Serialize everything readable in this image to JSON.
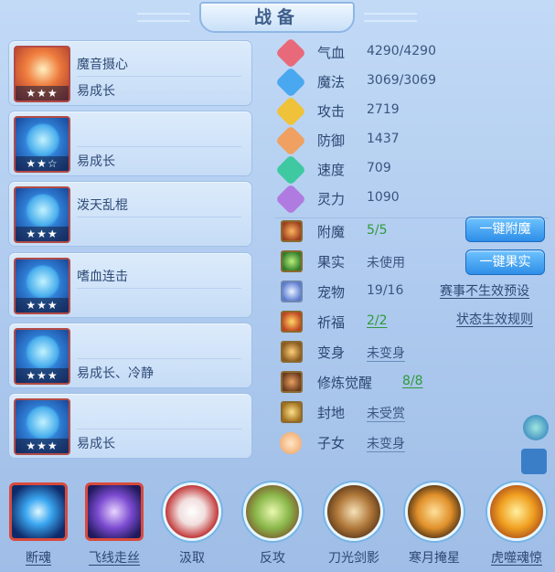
{
  "window": {
    "title": "战备"
  },
  "skills": [
    {
      "line1": "魔音摄心",
      "line2": "易成长",
      "stars": "★★★",
      "icon": "fire-popsicle-icon"
    },
    {
      "line1": "",
      "line2": "易成长",
      "stars": "★★☆",
      "icon": "blue-beast-icon"
    },
    {
      "line1": "泼天乱棍",
      "line2": "",
      "stars": "★★★",
      "icon": "blue-warrior-icon"
    },
    {
      "line1": "嗜血连击",
      "line2": "",
      "stars": "★★★",
      "icon": "blue-dragon-icon"
    },
    {
      "line1": "",
      "line2": "易成长、冷静",
      "stars": "★★★",
      "icon": "blue-armor-icon"
    },
    {
      "line1": "",
      "line2": "易成长",
      "stars": "★★★",
      "icon": "blue-spirit-icon"
    }
  ],
  "stats": [
    {
      "label": "气血",
      "value": "4290/4290",
      "icon": "heart-icon",
      "color": "#e86a7a"
    },
    {
      "label": "魔法",
      "value": "3069/3069",
      "icon": "mana-gem-icon",
      "color": "#4aa8f0"
    },
    {
      "label": "攻击",
      "value": "2719",
      "icon": "sword-icon",
      "color": "#f0c23a"
    },
    {
      "label": "防御",
      "value": "1437",
      "icon": "shield-icon",
      "color": "#f0a060"
    },
    {
      "label": "速度",
      "value": "709",
      "icon": "lightning-icon",
      "color": "#3ec9a0"
    },
    {
      "label": "灵力",
      "value": "1090",
      "icon": "spirit-icon",
      "color": "#b07be0"
    }
  ],
  "equipment": [
    {
      "label": "附魔",
      "value": "5/5",
      "icon": "enchant-icon"
    },
    {
      "label": "果实",
      "value": "未使用",
      "icon": "fruit-icon"
    },
    {
      "label": "宠物",
      "value": "19/16",
      "icon": "pet-icon"
    },
    {
      "label": "祈福",
      "value": "2/2",
      "icon": "bless-icon"
    },
    {
      "label": "变身",
      "value": "未变身",
      "icon": "transform-icon"
    },
    {
      "label": "修炼觉醒",
      "value": "8/8",
      "icon": "cultivate-icon"
    },
    {
      "label": "封地",
      "value": "未受赏",
      "icon": "fief-icon"
    },
    {
      "label": "子女",
      "value": "未变身",
      "icon": "child-icon"
    }
  ],
  "buttons": {
    "one_click_enchant": "一键附魔",
    "one_click_fruit": "一键果实"
  },
  "links": {
    "event_preset": "赛事不生效预设",
    "status_rules": "状态生效规则"
  },
  "bottom_skills": [
    {
      "label": "断魂",
      "icon": "blue-orb-icon"
    },
    {
      "label": "飞线走丝",
      "icon": "purple-swirl-icon"
    },
    {
      "label": "汲取",
      "icon": "red-swirl-icon"
    },
    {
      "label": "反攻",
      "icon": "green-claw-icon"
    },
    {
      "label": "刀光剑影",
      "icon": "blade-icon"
    },
    {
      "label": "寒月掩星",
      "icon": "moon-silhouette-icon"
    },
    {
      "label": "虎噬魂惊",
      "icon": "tiger-icon"
    }
  ]
}
